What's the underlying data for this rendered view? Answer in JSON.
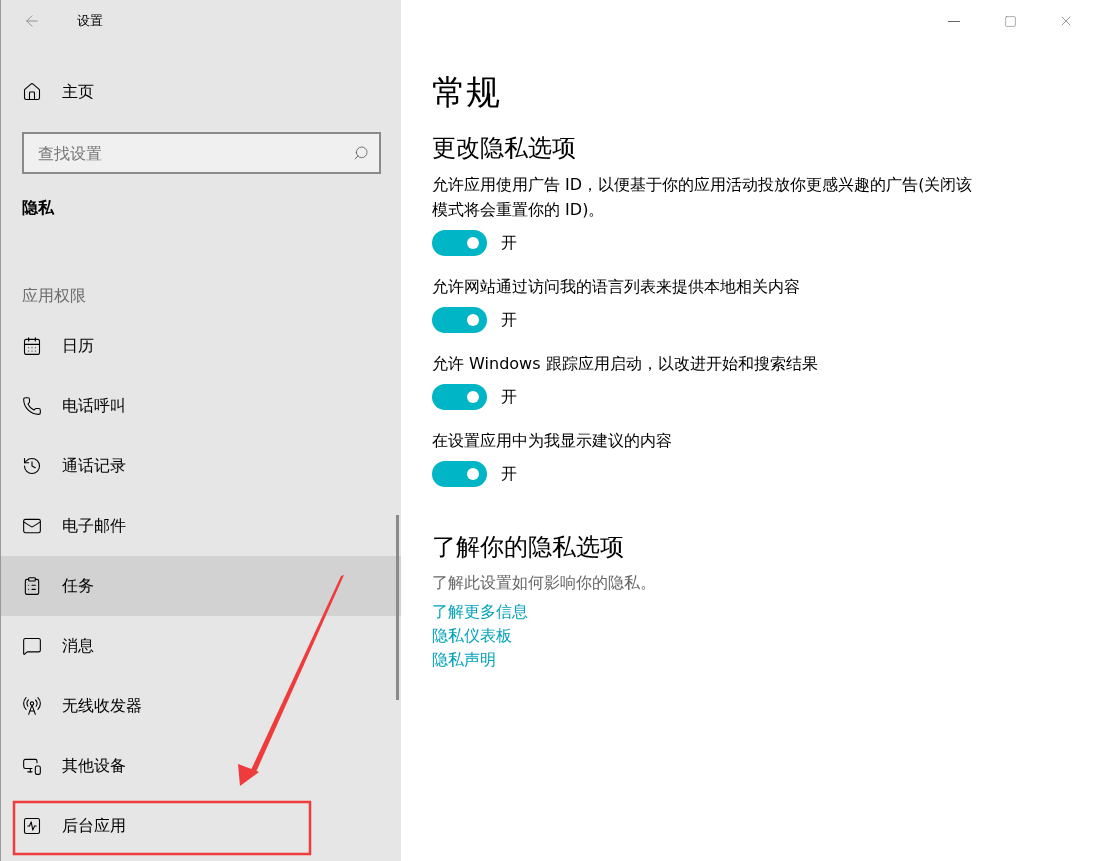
{
  "window": {
    "title": "设置"
  },
  "sidebar": {
    "home": "主页",
    "search": {
      "placeholder": "查找设置"
    },
    "section": "隐私",
    "category": "应用权限",
    "items": [
      {
        "label": "日历",
        "kind": "calendar",
        "hovered": false
      },
      {
        "label": "电话呼叫",
        "kind": "phone",
        "hovered": false
      },
      {
        "label": "通话记录",
        "kind": "history",
        "hovered": false
      },
      {
        "label": "电子邮件",
        "kind": "mail",
        "hovered": false
      },
      {
        "label": "任务",
        "kind": "tasks",
        "hovered": true
      },
      {
        "label": "消息",
        "kind": "message",
        "hovered": false
      },
      {
        "label": "无线收发器",
        "kind": "radio",
        "hovered": false
      },
      {
        "label": "其他设备",
        "kind": "devices",
        "hovered": false
      },
      {
        "label": "后台应用",
        "kind": "background",
        "hovered": false
      }
    ]
  },
  "main": {
    "title": "常规",
    "section_title": "更改隐私选项",
    "options": [
      {
        "description": "允许应用使用广告 ID，以便基于你的应用活动投放你更感兴趣的广告(关闭该模式将会重置你的 ID)。",
        "on": true,
        "state_label": "开"
      },
      {
        "description": "允许网站通过访问我的语言列表来提供本地相关内容",
        "on": true,
        "state_label": "开"
      },
      {
        "description": "允许 Windows 跟踪应用启动，以改进开始和搜索结果",
        "on": true,
        "state_label": "开"
      },
      {
        "description": "在设置应用中为我显示建议的内容",
        "on": true,
        "state_label": "开"
      }
    ],
    "about": {
      "title": "了解你的隐私选项",
      "text": "了解此设置如何影响你的隐私。",
      "links": [
        "了解更多信息",
        "隐私仪表板",
        "隐私声明"
      ]
    }
  }
}
